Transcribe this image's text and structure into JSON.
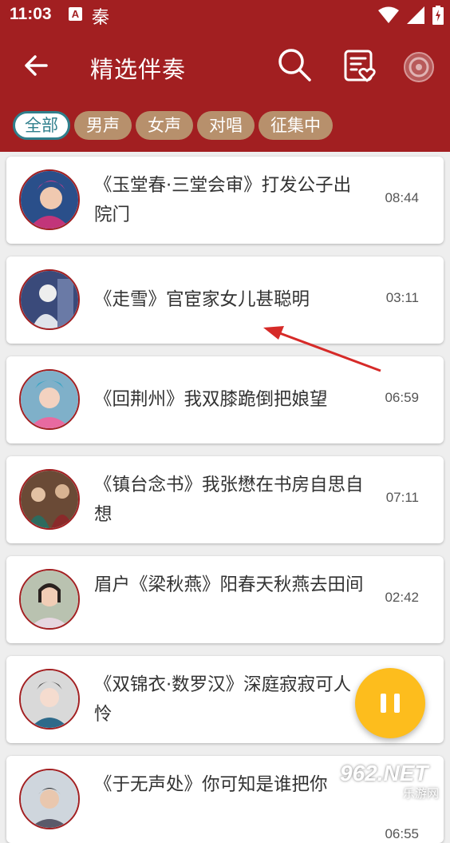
{
  "status_bar": {
    "time": "11:03",
    "notification_badge": "A",
    "notification_char": "秦"
  },
  "toolbar": {
    "title": "精选伴奏",
    "back_icon": "arrow-left-icon",
    "search_icon": "search-icon",
    "favorites_icon": "favorite-list-icon",
    "app_icon": "app-logo-icon"
  },
  "filters": [
    {
      "label": "全部",
      "active": true
    },
    {
      "label": "男声",
      "active": false
    },
    {
      "label": "女声",
      "active": false
    },
    {
      "label": "对唱",
      "active": false
    },
    {
      "label": "征集中",
      "active": false
    }
  ],
  "tracks": [
    {
      "title": "《玉堂春·三堂会审》打发公子出院门",
      "duration": "08:44"
    },
    {
      "title": "《走雪》官宦家女儿甚聪明",
      "duration": "03:11"
    },
    {
      "title": "《回荆州》我双膝跪倒把娘望",
      "duration": "06:59"
    },
    {
      "title": "《镇台念书》我张懋在书房自思自想",
      "duration": "07:11"
    },
    {
      "title": "眉户《梁秋燕》阳春天秋燕去田间",
      "duration": "02:42"
    },
    {
      "title": "《双锦衣·数罗汉》深庭寂寂可人怜",
      "duration": ""
    },
    {
      "title": "《于无声处》你可知是谁把你",
      "duration": "06:55"
    }
  ],
  "player": {
    "fab_icon": "pause-icon"
  },
  "watermark": {
    "main": "962.NET",
    "sub": "乐游网"
  },
  "colors": {
    "appbar": "#a21f21",
    "chip": "#b7906c",
    "chip_active": "#2f7f8c",
    "fab": "#fdbd1d"
  }
}
